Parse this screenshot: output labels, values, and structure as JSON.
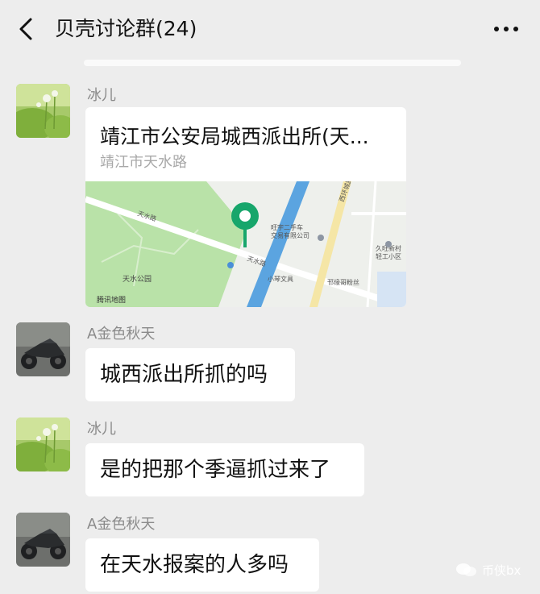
{
  "header": {
    "title": "贝壳讨论群(24)"
  },
  "messages": [
    {
      "sender": "冰儿",
      "type": "location",
      "location": {
        "title": "靖江市公安局城西派出所(天...",
        "address": "靖江市天水路",
        "map_labels": {
          "road_top": "天水路",
          "road_mid": "天水路",
          "park": "天水公园",
          "poi_1": "旺宇二手车\n交易有限公司",
          "poi_2": "小琴文具",
          "poi_3": "邗缘哥粉丝",
          "poi_4": "久旺新村\n轻工小区",
          "road_vertical": "西环城路",
          "provider": "腾讯地图"
        }
      }
    },
    {
      "sender": "A金色秋天",
      "type": "text",
      "text": "城西派出所抓的吗"
    },
    {
      "sender": "冰儿",
      "type": "text",
      "text": "是的把那个季逼抓过来了"
    },
    {
      "sender": "A金色秋天",
      "type": "text",
      "text": "在天水报案的人多吗"
    }
  ],
  "watermark": {
    "text": "币侠bx"
  },
  "colors": {
    "background": "#ededed",
    "bubble": "#ffffff",
    "pin": "#17a66b",
    "river": "#5ba4e0",
    "park": "#b9e2a8"
  }
}
